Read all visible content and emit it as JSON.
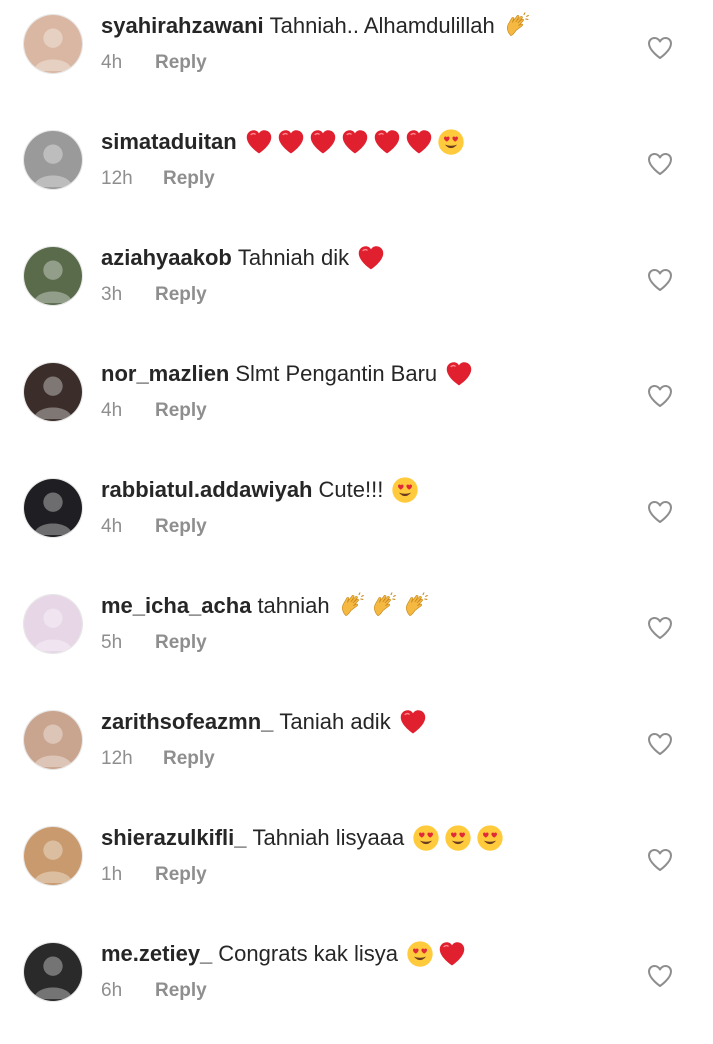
{
  "reply_label": "Reply",
  "comments": [
    {
      "username": "syahirahzawani",
      "text": "Tahniah.. Alhamdulillah",
      "emojis": [
        "clapping-hands"
      ],
      "time": "4h",
      "avatar_color": "#d9b7a2"
    },
    {
      "username": "simataduitan",
      "text": "",
      "emojis": [
        "red-heart",
        "red-heart",
        "red-heart",
        "red-heart",
        "red-heart",
        "red-heart",
        "heart-eyes"
      ],
      "time": "12h",
      "avatar_color": "#9a9a9a"
    },
    {
      "username": "aziahyaakob",
      "text": "Tahniah dik",
      "emojis": [
        "red-heart"
      ],
      "time": "3h",
      "avatar_color": "#5a6b4c"
    },
    {
      "username": "nor_mazlien",
      "text": "Slmt Pengantin Baru",
      "emojis": [
        "red-heart"
      ],
      "time": "4h",
      "avatar_color": "#3b2e2a"
    },
    {
      "username": "rabbiatul.addawiyah",
      "text": "Cute!!!",
      "emojis": [
        "heart-eyes"
      ],
      "time": "4h",
      "avatar_color": "#1f1f23"
    },
    {
      "username": "me_icha_acha",
      "text": "tahniah",
      "emojis": [
        "clapping-hands",
        "clapping-hands",
        "clapping-hands"
      ],
      "time": "5h",
      "avatar_color": "#e6d6e6"
    },
    {
      "username": "zarithsofeazmn_",
      "text": "Taniah adik",
      "emojis": [
        "red-heart"
      ],
      "time": "12h",
      "avatar_color": "#c9a58f"
    },
    {
      "username": "shierazulkifli_",
      "text": "Tahniah lisyaaa",
      "emojis": [
        "heart-eyes",
        "heart-eyes",
        "heart-eyes"
      ],
      "time": "1h",
      "avatar_color": "#c89a6e"
    },
    {
      "username": "me.zetiey_",
      "text": "Congrats kak lisya",
      "emojis": [
        "heart-eyes",
        "red-heart"
      ],
      "time": "6h",
      "avatar_color": "#2a2a2a"
    }
  ]
}
